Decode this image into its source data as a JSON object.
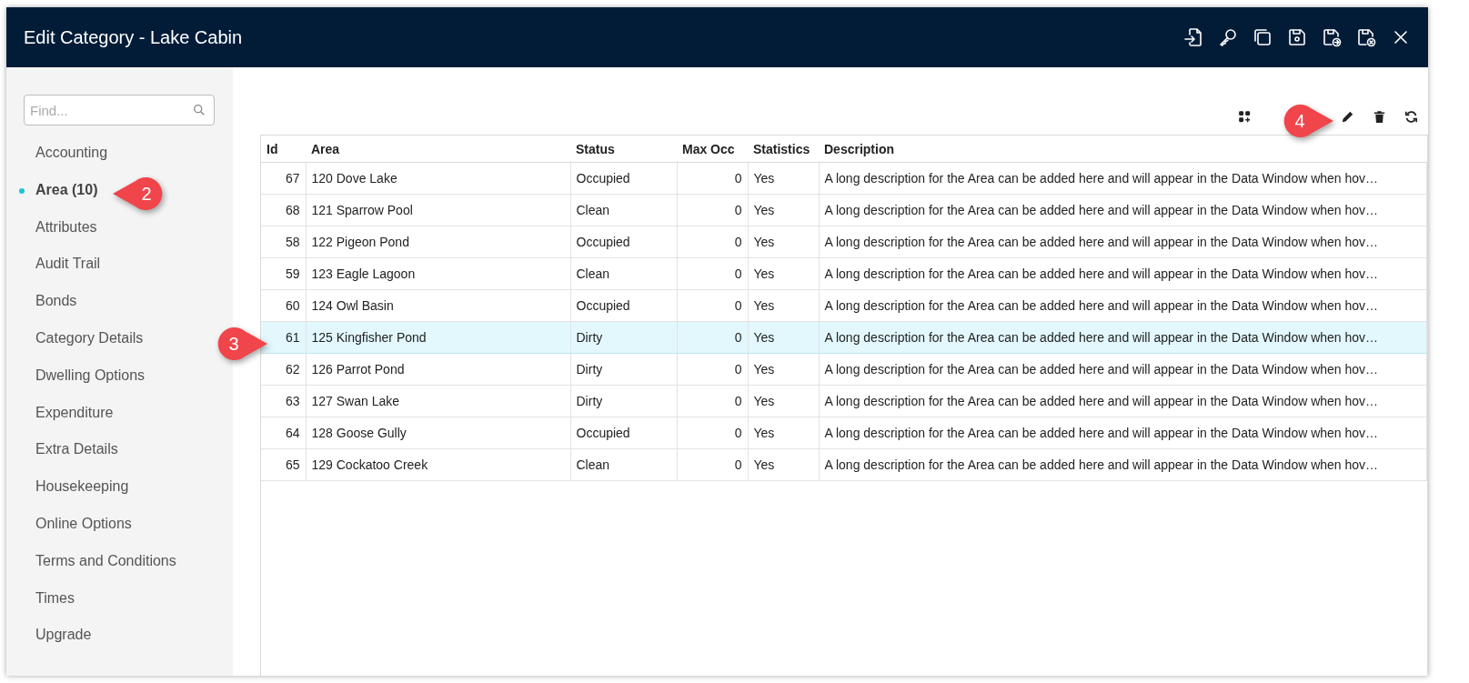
{
  "window": {
    "title": "Edit Category - Lake Cabin"
  },
  "sidebar": {
    "search": {
      "placeholder": "Find..."
    },
    "items": [
      {
        "label": "Accounting",
        "selected": false
      },
      {
        "label": "Area (10)",
        "selected": true
      },
      {
        "label": "Attributes",
        "selected": false
      },
      {
        "label": "Audit Trail",
        "selected": false
      },
      {
        "label": "Bonds",
        "selected": false
      },
      {
        "label": "Category Details",
        "selected": false
      },
      {
        "label": "Dwelling Options",
        "selected": false
      },
      {
        "label": "Expenditure",
        "selected": false
      },
      {
        "label": "Extra Details",
        "selected": false
      },
      {
        "label": "Housekeeping",
        "selected": false
      },
      {
        "label": "Online Options",
        "selected": false
      },
      {
        "label": "Terms and Conditions",
        "selected": false
      },
      {
        "label": "Times",
        "selected": false
      },
      {
        "label": "Upgrade",
        "selected": false
      }
    ]
  },
  "table": {
    "columns": [
      "Id",
      "Area",
      "Status",
      "Max Occ",
      "Statistics",
      "Description"
    ],
    "rows": [
      {
        "cells": [
          "67",
          "120 Dove Lake",
          "Occupied",
          "0",
          "Yes",
          "A long description for the Area can be added here and will appear in the Data Window when hov…"
        ],
        "selected": false
      },
      {
        "cells": [
          "68",
          "121 Sparrow Pool",
          "Clean",
          "0",
          "Yes",
          "A long description for the Area can be added here and will appear in the Data Window when hov…"
        ],
        "selected": false
      },
      {
        "cells": [
          "58",
          "122 Pigeon Pond",
          "Occupied",
          "0",
          "Yes",
          "A long description for the Area can be added here and will appear in the Data Window when hov…"
        ],
        "selected": false
      },
      {
        "cells": [
          "59",
          "123 Eagle Lagoon",
          "Clean",
          "0",
          "Yes",
          "A long description for the Area can be added here and will appear in the Data Window when hov…"
        ],
        "selected": false
      },
      {
        "cells": [
          "60",
          "124 Owl Basin",
          "Occupied",
          "0",
          "Yes",
          "A long description for the Area can be added here and will appear in the Data Window when hov…"
        ],
        "selected": false
      },
      {
        "cells": [
          "61",
          "125 Kingfisher Pond",
          "Dirty",
          "0",
          "Yes",
          "A long description for the Area can be added here and will appear in the Data Window when hov…"
        ],
        "selected": true
      },
      {
        "cells": [
          "62",
          "126 Parrot Pond",
          "Dirty",
          "0",
          "Yes",
          "A long description for the Area can be added here and will appear in the Data Window when hov…"
        ],
        "selected": false
      },
      {
        "cells": [
          "63",
          "127 Swan Lake",
          "Dirty",
          "0",
          "Yes",
          "A long description for the Area can be added here and will appear in the Data Window when hov…"
        ],
        "selected": false
      },
      {
        "cells": [
          "64",
          "128 Goose Gully",
          "Occupied",
          "0",
          "Yes",
          "A long description for the Area can be added here and will appear in the Data Window when hov…"
        ],
        "selected": false
      },
      {
        "cells": [
          "65",
          "129 Cockatoo Creek",
          "Clean",
          "0",
          "Yes",
          "A long description for the Area can be added here and will appear in the Data Window when hov…"
        ],
        "selected": false
      }
    ]
  },
  "callouts": [
    {
      "number": "2",
      "kind": "left"
    },
    {
      "number": "3",
      "kind": "right"
    },
    {
      "number": "4",
      "kind": "right"
    }
  ]
}
